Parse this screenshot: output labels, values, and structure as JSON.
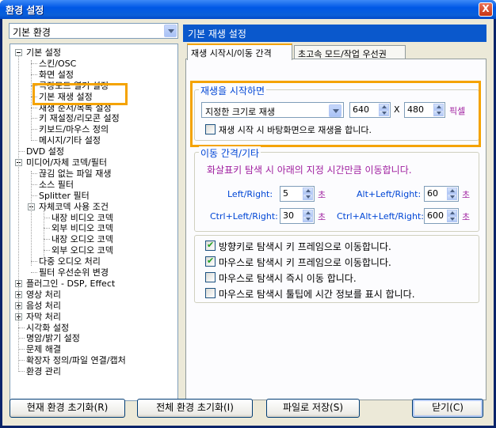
{
  "window": {
    "title": "환경 설정",
    "close_glyph": "X"
  },
  "left": {
    "preset_combo": "기본 환경",
    "tree": [
      {
        "label": "기본 설정",
        "expander": "minus"
      },
      {
        "label": "스킨/OSC"
      },
      {
        "label": "화면 설정"
      },
      {
        "label": "극장모드 열기 설정"
      },
      {
        "label": "기본 재생 설정"
      },
      {
        "label": "재생 순서/목록 설정"
      },
      {
        "label": "키 재설정/리모콘 설정"
      },
      {
        "label": "키보드/마우스 정의"
      },
      {
        "label": "메시지/기타 설정"
      },
      {
        "label": "DVD 설정"
      },
      {
        "label": "미디어/자체 코덱/필터",
        "expander": "minus"
      },
      {
        "label": "끊김 없는 파일 재생"
      },
      {
        "label": "소스 필터"
      },
      {
        "label": "Splitter 필터"
      },
      {
        "label": "자체코덱 사용 조건",
        "expander": "minus"
      },
      {
        "label": "내장 비디오 코덱"
      },
      {
        "label": "외부 비디오 코덱"
      },
      {
        "label": "내장 오디오 코덱"
      },
      {
        "label": "외부 오디오 코덱"
      },
      {
        "label": "다중 오디오 처리"
      },
      {
        "label": "필터 우선순위 변경"
      },
      {
        "label": "플러그인 - DSP, Effect",
        "expander": "plus"
      },
      {
        "label": "영상 처리",
        "expander": "plus"
      },
      {
        "label": "음성 처리",
        "expander": "plus"
      },
      {
        "label": "자막 처리",
        "expander": "plus"
      },
      {
        "label": "시각화 설정"
      },
      {
        "label": "명암/밝기 설정"
      },
      {
        "label": "문제 해결"
      },
      {
        "label": "확장자 정의/파일 연결/캡처"
      },
      {
        "label": "환경 관리"
      }
    ]
  },
  "right": {
    "header": "기본 재생 설정",
    "tabs": [
      {
        "label": "재생 시작시/이동 간격",
        "active": true
      },
      {
        "label": "초고속 모드/작업 우선권",
        "active": false
      }
    ],
    "start_group": {
      "title": "재생을 시작하면",
      "size_mode": "지정한 크기로 재생",
      "width": "640",
      "times": "X",
      "height": "480",
      "unit": "픽셀",
      "desktop_check_label": "재생 시작 시 바탕화면으로 재생을 합니다.",
      "desktop_check": false
    },
    "move_group": {
      "title": "이동 간격/기타",
      "desc": "화살표키 탐색 시 아래의 지정 시간만큼 이동합니다.",
      "rows": [
        {
          "label": "Left/Right:",
          "value": "5",
          "unit": "초",
          "label2": "Alt+Left/Right:",
          "value2": "60",
          "unit2": "초"
        },
        {
          "label": "Ctrl+Left/Right:",
          "value": "30",
          "unit": "초",
          "label2": "Ctrl+Alt+Left/Right:",
          "value2": "600",
          "unit2": "초"
        }
      ]
    },
    "checks": [
      {
        "label": "방향키로 탐색시 키 프레임으로 이동합니다.",
        "checked": true
      },
      {
        "label": "마우스로 탐색시 키 프레임으로 이동합니다.",
        "checked": true
      },
      {
        "label": "마우스로 탐색시 즉시 이동 합니다.",
        "checked": false
      },
      {
        "label": "마우스로 탐색시 툴팁에 시간 정보를 표시 합니다.",
        "checked": false
      }
    ]
  },
  "buttons": {
    "reset_current": "현재 환경 초기화(R)",
    "reset_all": "전체 환경 초기화(I)",
    "save_file": "파일로 저장(S)",
    "close": "닫기(C)"
  },
  "colors": {
    "accent_highlight": "#f4a300",
    "header_blue": "#0a58cc"
  }
}
